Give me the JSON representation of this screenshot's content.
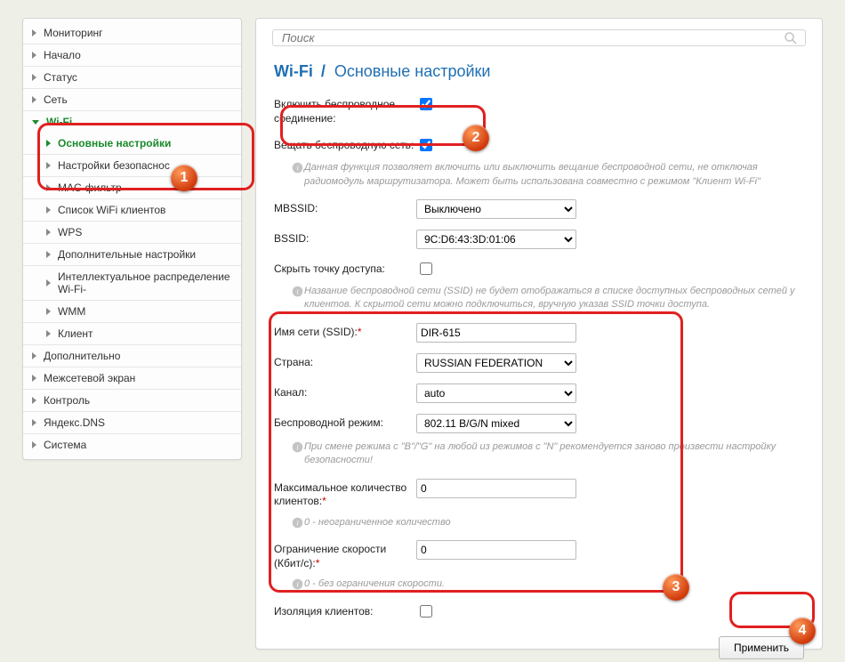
{
  "search": {
    "placeholder": "Поиск"
  },
  "breadcrumb": {
    "section": "Wi-Fi",
    "page": "Основные настройки"
  },
  "sidebar": {
    "items": [
      {
        "label": "Мониторинг"
      },
      {
        "label": "Начало"
      },
      {
        "label": "Статус"
      },
      {
        "label": "Сеть"
      },
      {
        "label": "Wi-Fi",
        "expanded": true,
        "children": [
          {
            "label": "Основные настройки",
            "active": true
          },
          {
            "label": "Настройки безопаснос"
          },
          {
            "label": "MAC-фильтр"
          },
          {
            "label": "Список WiFi клиентов"
          },
          {
            "label": "WPS"
          },
          {
            "label": "Дополнительные настройки"
          },
          {
            "label": "Интеллектуальное распределение Wi-Fi-"
          },
          {
            "label": "WMM"
          },
          {
            "label": "Клиент"
          }
        ]
      },
      {
        "label": "Дополнительно"
      },
      {
        "label": "Межсетевой экран"
      },
      {
        "label": "Контроль"
      },
      {
        "label": "Яндекс.DNS"
      },
      {
        "label": "Система"
      }
    ]
  },
  "form": {
    "enable_wireless": {
      "label": "Включить беспроводное соединение:",
      "checked": true
    },
    "broadcast": {
      "label": "Вещать беспроводную сеть:",
      "checked": true,
      "hint": "Данная функция позволяет включить или выключить вещание беспроводной сети, не отключая радиомодуль маршрутизатора. Может быть использована совместно с режимом \"Клиент Wi-Fi\""
    },
    "mbssid": {
      "label": "MBSSID:",
      "value": "Выключено",
      "options": [
        "Выключено"
      ]
    },
    "bssid": {
      "label": "BSSID:",
      "value": "9C:D6:43:3D:01:06",
      "options": [
        "9C:D6:43:3D:01:06"
      ]
    },
    "hide_ap": {
      "label": "Скрыть точку доступа:",
      "checked": false,
      "hint": "Название беспроводной сети (SSID) не будет отображаться в списке доступных беспроводных сетей у клиентов. К скрытой сети можно подключиться, вручную указав SSID точки доступа."
    },
    "ssid": {
      "label": "Имя сети (SSID):",
      "required": true,
      "value": "DIR-615"
    },
    "country": {
      "label": "Страна:",
      "value": "RUSSIAN FEDERATION",
      "options": [
        "RUSSIAN FEDERATION"
      ]
    },
    "channel": {
      "label": "Канал:",
      "value": "auto",
      "options": [
        "auto"
      ]
    },
    "mode": {
      "label": "Беспроводной режим:",
      "value": "802.11 B/G/N mixed",
      "options": [
        "802.11 B/G/N mixed"
      ],
      "hint": "При смене режима с \"B\"/\"G\" на любой из режимов с \"N\" рекомендуется заново произвести настройку безопасности!"
    },
    "max_clients": {
      "label": "Максимальное количество клиентов:",
      "required": true,
      "value": "0",
      "hint": "0 - неограниченное количество"
    },
    "rate_limit": {
      "label": "Ограничение скорости (Кбит/c):",
      "required": true,
      "value": "0",
      "hint": "0 - без ограничения скорости."
    },
    "isolation": {
      "label": "Изоляция клиентов:",
      "checked": false
    }
  },
  "buttons": {
    "apply": "Применить"
  }
}
